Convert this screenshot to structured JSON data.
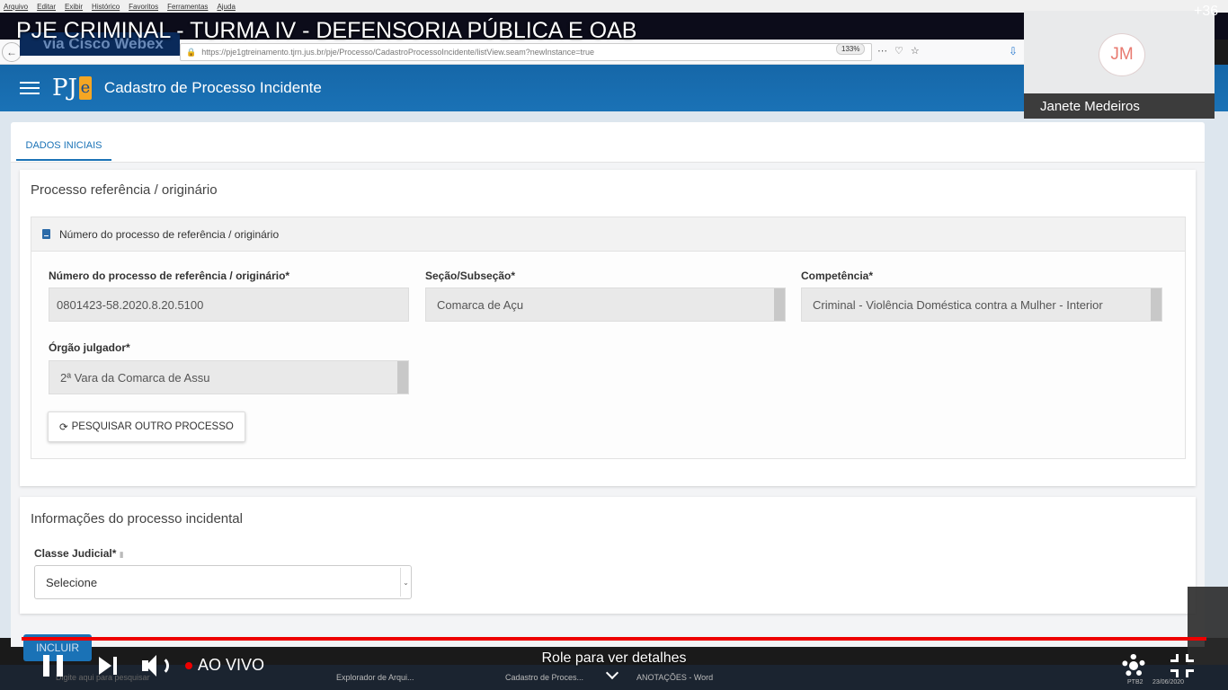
{
  "browser": {
    "menu": [
      "Arquivo",
      "Editar",
      "Exibir",
      "Histórico",
      "Favoritos",
      "Ferramentas",
      "Ajuda"
    ],
    "url": "https://pje1gtreinamento.tjrn.jus.br/pje/Processo/CadastroProcessoIncidente/listView.seam?newInstance=true",
    "zoom": "133%"
  },
  "webex": {
    "label": "via Cisco Webex"
  },
  "app": {
    "logo": "PJ",
    "logo_e": "e",
    "title": "Cadastro de Processo Incidente"
  },
  "tabs": {
    "dados_iniciais": "DADOS INICIAIS"
  },
  "section1": {
    "title": "Processo referência / originário",
    "subsection": "Número do processo de referência / originário",
    "fields": {
      "numero_label": "Número do processo de referência / originário*",
      "numero_value": "0801423-58.2020.8.20.5100",
      "secao_label": "Seção/Subseção*",
      "secao_value": "Comarca de Açu",
      "competencia_label": "Competência*",
      "competencia_value": "Criminal - Violência Doméstica contra a Mulher - Interior",
      "orgao_label": "Órgão julgador*",
      "orgao_value": "2ª Vara da Comarca de Assu"
    },
    "search_button": "PESQUISAR OUTRO PROCESSO"
  },
  "section2": {
    "title": "Informações do processo incidental",
    "classe_label": "Classe Judicial*",
    "classe_value": "Selecione"
  },
  "include_button": "INCLUIR",
  "video": {
    "title": "PJE CRIMINAL - TURMA IV - DEFENSORIA PÚBLICA E OAB",
    "participant_initials": "JM",
    "participant_name": "Janete Medeiros",
    "live_label": "AO VIVO",
    "scroll_hint": "Role para ver detalhes",
    "extra_count": "+36",
    "progress_color": "#ee0000"
  },
  "taskbar": {
    "search_placeholder": "Digite aqui para pesquisar",
    "items": [
      "Explorador de Arqui...",
      "Cadastro de Proces...",
      "ANOTAÇÕES - Word"
    ],
    "lang": "PTB2",
    "date": "23/06/2020"
  },
  "colors": {
    "header": "#1a72b6",
    "accent": "#1a72b6",
    "live": "#ee0000"
  }
}
